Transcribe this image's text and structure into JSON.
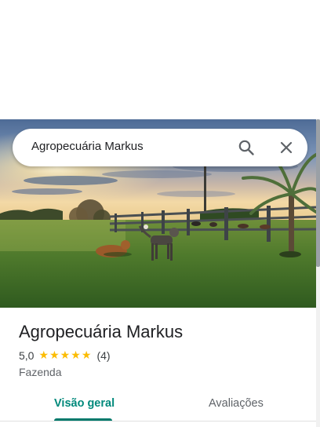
{
  "search": {
    "query": "Agropecuária Markus",
    "search_icon": "search-icon",
    "close_icon": "close-icon"
  },
  "hero": {
    "image": "farm-photo-dogs-sunset"
  },
  "place": {
    "name": "Agropecuária Markus",
    "rating": "5,0",
    "stars": 5,
    "review_count": "(4)",
    "category": "Fazenda"
  },
  "tabs": [
    {
      "label": "Visão geral",
      "active": true
    },
    {
      "label": "Avaliações",
      "active": false
    }
  ],
  "colors": {
    "accent": "#00796b",
    "star": "#fbbc04",
    "text_primary": "#202124",
    "text_secondary": "#5f6368"
  }
}
